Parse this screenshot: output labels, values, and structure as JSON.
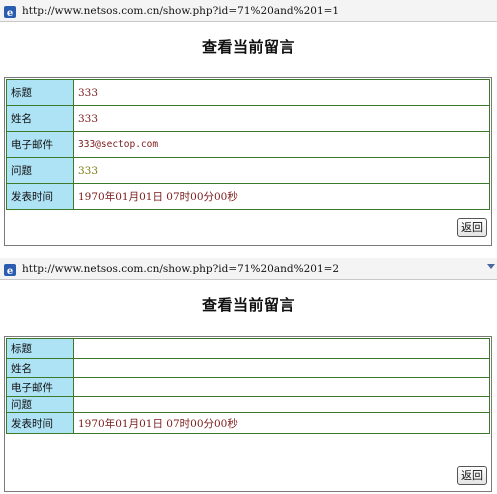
{
  "colors": {
    "label_bg": "#aee3f6",
    "border": "#3c7a2a",
    "value_text": "#7a1a1a",
    "olive_text": "#7c7a10"
  },
  "screens": [
    {
      "address": {
        "icon": "ie-page-icon",
        "url": "http://www.netsos.com.cn/show.php?id=71%20and%201=1"
      },
      "title": "查看当前留言",
      "rows": [
        {
          "label": "标题",
          "value": "333"
        },
        {
          "label": "姓名",
          "value": "333"
        },
        {
          "label": "电子邮件",
          "value": "333@sectop.com"
        },
        {
          "label": "问题",
          "value": "333"
        },
        {
          "label": "发表时间",
          "value": "1970年01月01日 07时00分00秒"
        }
      ],
      "back_label": "返回"
    },
    {
      "address": {
        "icon": "ie-page-icon",
        "url": "http://www.netsos.com.cn/show.php?id=71%20and%201=2"
      },
      "title": "查看当前留言",
      "rows": [
        {
          "label": "标题",
          "value": ""
        },
        {
          "label": "姓名",
          "value": ""
        },
        {
          "label": "电子邮件",
          "value": ""
        },
        {
          "label": "问题",
          "value": ""
        },
        {
          "label": "发表时间",
          "value": "1970年01月01日 07时00分00秒"
        }
      ],
      "back_label": "返回"
    }
  ]
}
